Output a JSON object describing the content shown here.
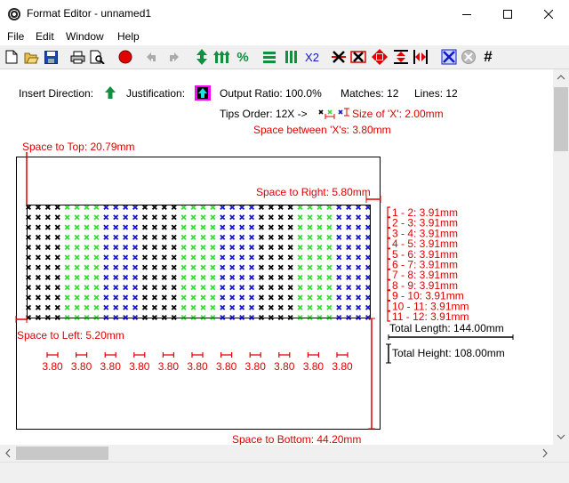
{
  "window": {
    "title": "Format Editor - unnamed1"
  },
  "menu": {
    "items": [
      "File",
      "Edit",
      "Window",
      "Help"
    ]
  },
  "toolbar": {
    "buttons": [
      "new-icon",
      "open-icon",
      "save-icon",
      "print-icon",
      "print-preview-icon",
      "record-icon",
      "undo-icon",
      "redo-icon",
      "insert-direction-icon",
      "justification-icon",
      "percent-icon",
      "align-lines-icon",
      "align-columns-icon",
      "x2",
      "delete-x-icon",
      "delete-box-icon",
      "center-icon",
      "vertical-spacing-icon",
      "horizontal-spacing-icon",
      "grid-x-icon",
      "circle-x-icon",
      "hash-icon"
    ],
    "percent_label": "%",
    "x2_label": "X2",
    "hash_label": "#"
  },
  "info": {
    "insert_direction_label": "Insert Direction:",
    "justification_label": "Justification:",
    "output_ratio": "Output Ratio: 100.0%",
    "matches": "Matches: 12",
    "lines": "Lines: 12",
    "tips_order": "Tips Order: 12X ->",
    "size_of_x": "Size of 'X': 2.00mm",
    "space_between": "Space between 'X's: 3.80mm"
  },
  "diagram": {
    "space_to_top": "Space to Top: 20.79mm",
    "space_to_right": "Space to Right: 5.80mm",
    "space_to_left": "Space to Left: 5.20mm",
    "space_to_bottom": "Space to Bottom: 44.20mm",
    "total_length": "Total Length: 144.00mm",
    "total_height": "Total Height: 108.00mm",
    "line_spacings": [
      "1 - 2: 3.91mm",
      "2 - 3: 3.91mm",
      "3 - 4: 3.91mm",
      "4 - 5: 3.91mm",
      "5 - 6: 3.91mm",
      "6 - 7: 3.91mm",
      "7 - 8: 3.91mm",
      "8 - 9: 3.91mm",
      "9 - 10: 3.91mm",
      "10 - 11: 3.91mm",
      "11 - 12: 3.91mm"
    ],
    "x_spacings": [
      "3.80",
      "3.80",
      "3.80",
      "3.80",
      "3.80",
      "3.80",
      "3.80",
      "3.80",
      "3.80",
      "3.80",
      "3.80"
    ],
    "x_colors": [
      "#000000",
      "#33dd33",
      "#1515d0"
    ],
    "rows": 12,
    "columns": 36
  }
}
